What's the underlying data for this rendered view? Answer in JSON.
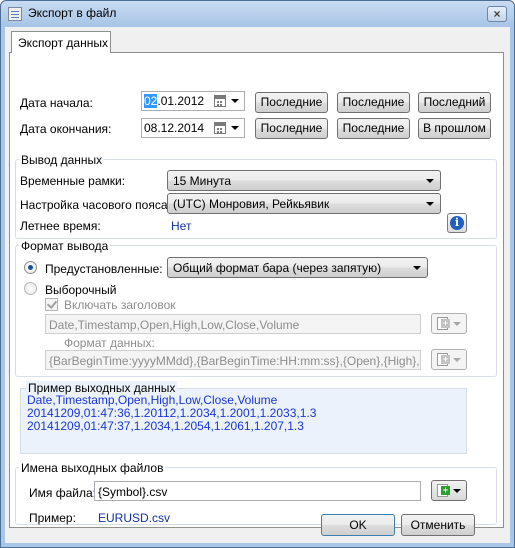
{
  "window": {
    "title": "Экспорт в файл",
    "close_glyph": "×"
  },
  "tab": {
    "label": "Экспорт данных"
  },
  "dates": {
    "start_label": "Дата начала:",
    "start_value_highlight": "02",
    "start_value_rest": ".01.2012",
    "end_label": "Дата окончания:",
    "end_value": "08.12.2014",
    "start_buttons": [
      "Последние",
      "Последние",
      "Последний"
    ],
    "end_buttons": [
      "Последние",
      "Последние",
      "В прошлом"
    ]
  },
  "output": {
    "group_title": "Вывод данных",
    "timeframe_label": "Временные рамки:",
    "timeframe_value": "15 Минута",
    "timezone_label": "Настройка часового пояса:",
    "timezone_value": "(UTC) Монровия, Рейкьявик",
    "dst_label": "Летнее время:",
    "dst_value": "Нет"
  },
  "format": {
    "group_title": "Формат вывода",
    "preset_label": "Предустановленные:",
    "preset_value": "Общий формат бара (через запятую)",
    "custom_label": "Выборочный",
    "include_header_label": "Включать заголовок",
    "header_value": "Date,Timestamp,Open,High,Low,Close,Volume",
    "data_format_label": "Формат данных:",
    "data_format_value": "{BarBeginTime:yyyyMMdd},{BarBeginTime:HH:mm:ss},{Open},{High},{Low},{C"
  },
  "sample": {
    "group_title": "Пример выходных данных",
    "lines": [
      "Date,Timestamp,Open,High,Low,Close,Volume",
      "20141209,01:47:36,1.20112,1.2034,1.2001,1.2033,1.3",
      "20141209,01:47:37,1.2034,1.2054,1.2061,1.207,1.3"
    ]
  },
  "filenames": {
    "group_title": "Имена выходных файлов",
    "filename_label": "Имя файла:",
    "filename_value": "{Symbol}.csv",
    "example_label": "Пример:",
    "example_value": "EURUSD.csv"
  },
  "footer": {
    "ok_label": "OK",
    "cancel_label": "Отменить"
  },
  "colors": {
    "accent_blue": "#1330a8",
    "sample_text": "#1a36d6",
    "sample_bg": "#ebf2fc"
  },
  "icons": [
    "calendar-icon",
    "info-icon",
    "insert-token-icon",
    "chevron-down-icon",
    "close-icon"
  ]
}
